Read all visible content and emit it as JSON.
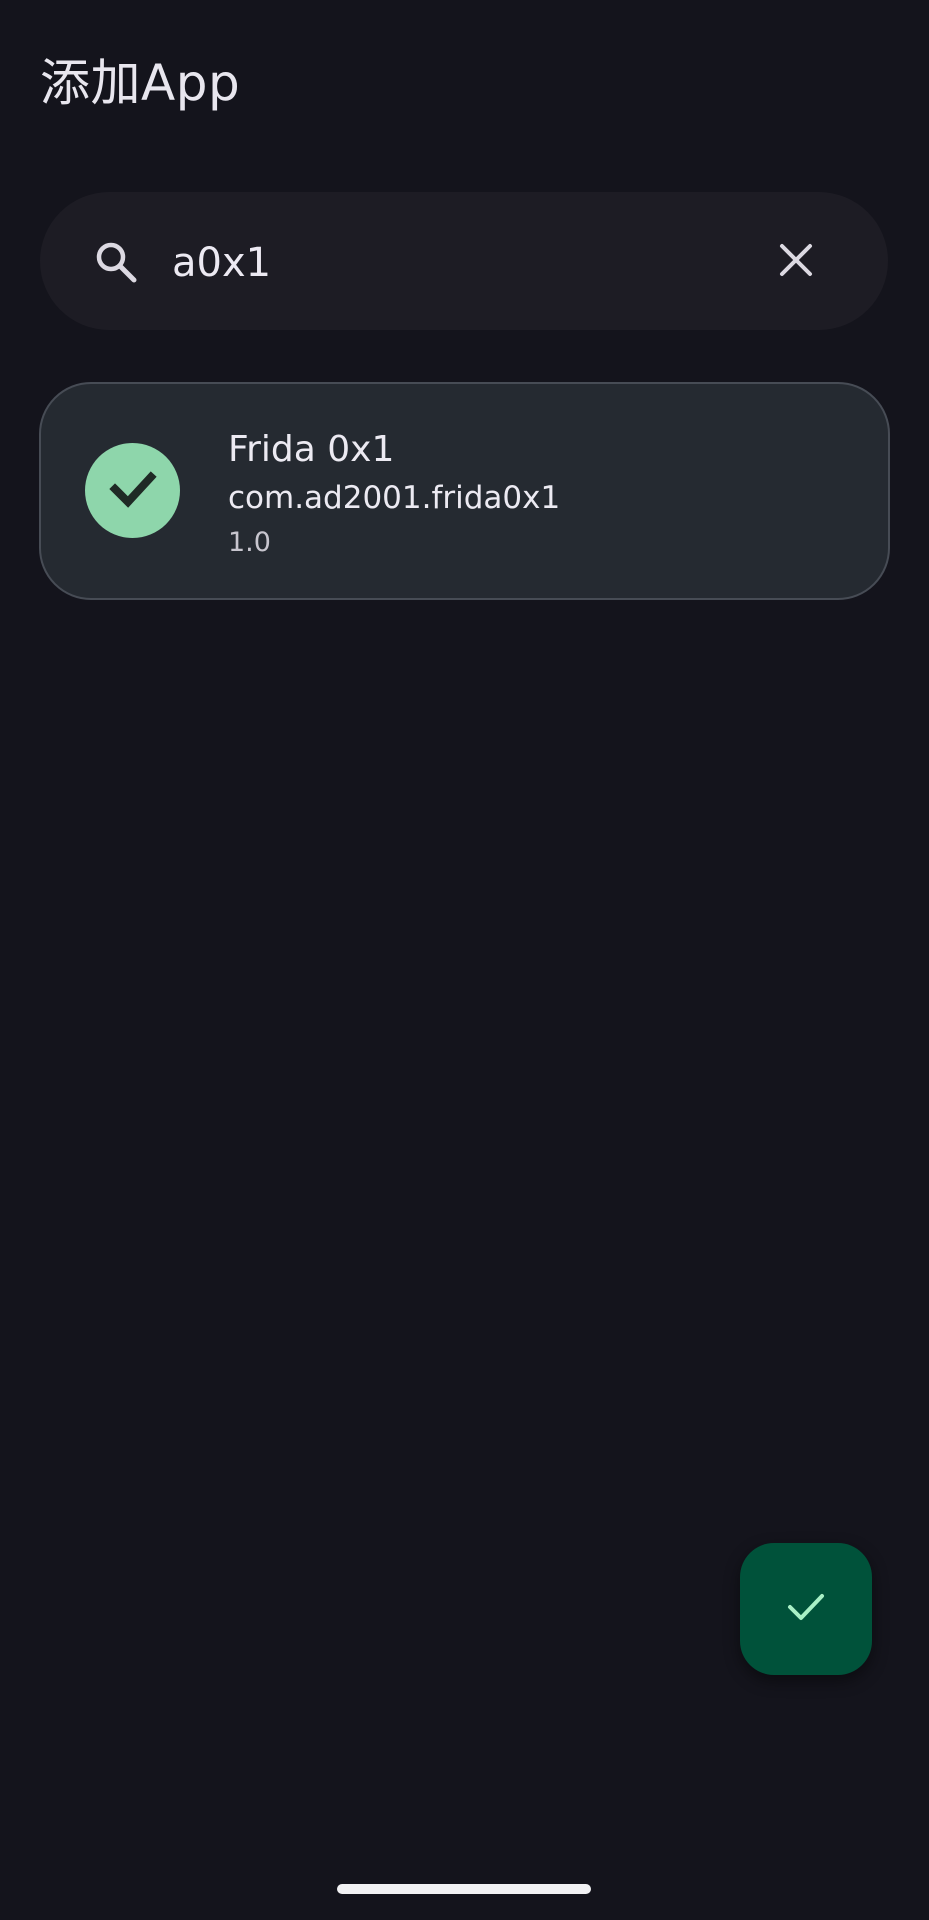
{
  "header": {
    "title": "添加App"
  },
  "search": {
    "value": "a0x1",
    "search_icon": "search-icon",
    "clear_icon": "close-icon"
  },
  "apps": [
    {
      "name": "Frida 0x1",
      "package": "com.ad2001.frida0x1",
      "version": "1.0",
      "selected": true,
      "status_icon": "check-icon"
    }
  ],
  "fab": {
    "icon": "check-icon"
  },
  "colors": {
    "background": "#14141c",
    "search_bar": "#1d1c24",
    "card": "#252a31",
    "check_circle": "#8ed6ab",
    "fab": "#00523a",
    "fab_icon": "#a8f0c6"
  }
}
